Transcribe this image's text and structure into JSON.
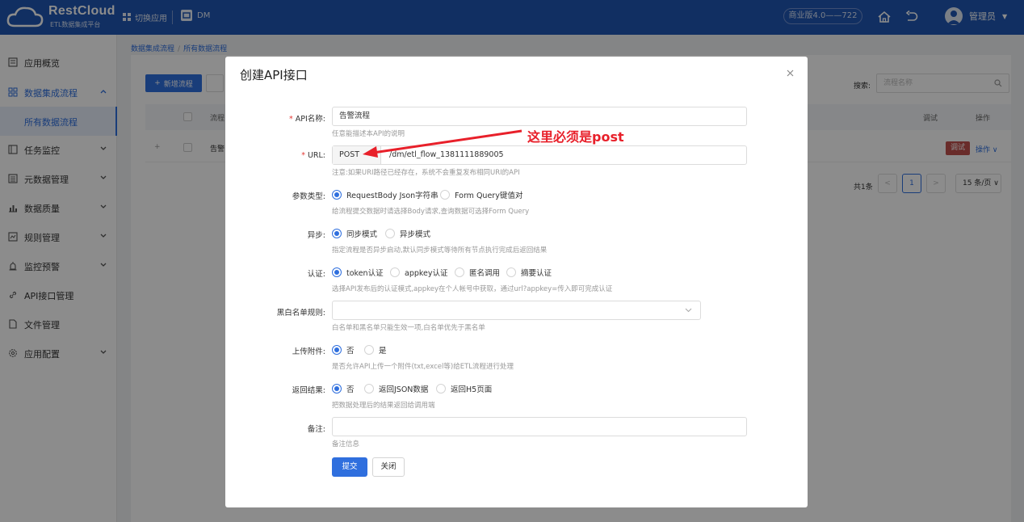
{
  "header": {
    "logo_title": "RestCloud",
    "logo_subtitle": "ETL数据集成平台",
    "switch_app": "切换应用",
    "app_name": "DM",
    "version": "商业版4.0——722",
    "user": "管理员"
  },
  "sidebar": {
    "items": [
      {
        "label": "应用概览",
        "icon": "overview-icon"
      },
      {
        "label": "数据集成流程",
        "icon": "grid-icon",
        "expanded": true
      },
      {
        "label": "所有数据流程",
        "active": true
      },
      {
        "label": "任务监控",
        "icon": "monitor-icon"
      },
      {
        "label": "元数据管理",
        "icon": "list-icon"
      },
      {
        "label": "数据质量",
        "icon": "bar-chart-icon"
      },
      {
        "label": "规则管理",
        "icon": "rule-icon"
      },
      {
        "label": "监控预警",
        "icon": "alarm-icon"
      },
      {
        "label": "API接口管理",
        "icon": "link-icon"
      },
      {
        "label": "文件管理",
        "icon": "file-icon"
      },
      {
        "label": "应用配置",
        "icon": "settings-icon"
      }
    ]
  },
  "breadcrumb": [
    "数据集成流程",
    "所有数据流程"
  ],
  "main": {
    "add_label": "新增流程",
    "search_label": "搜索:",
    "search_placeholder": "流程名称",
    "columns": [
      "流程",
      "调试",
      "操作"
    ],
    "row": {
      "name": "告警",
      "debug": "调试",
      "action": "操作"
    },
    "total": "共1条",
    "page": "1",
    "page_size": "15 条/页"
  },
  "modal": {
    "title": "创建API接口",
    "api_name_label": "API名称:",
    "api_name_value": "告警流程",
    "api_name_help": "任意能描述本API的说明",
    "url_label": "URL:",
    "url_method": "POST",
    "url_value": "/dm/etl_flow_1381111889005",
    "url_help": "注意:如果URI路径已经存在，系统不会重复发布相同URI的API",
    "param_label": "参数类型:",
    "param_options": [
      "RequestBody Json字符串",
      "Form Query键值对"
    ],
    "param_help": "给流程提交数据时请选择Body请求,查询数据可选择Form Query",
    "async_label": "异步:",
    "async_options": [
      "同步模式",
      "异步模式"
    ],
    "async_help": "指定流程是否异步启动,默认同步模式等待所有节点执行完成后返回结果",
    "auth_label": "认证:",
    "auth_options": [
      "token认证",
      "appkey认证",
      "匿名调用",
      "摘要认证"
    ],
    "auth_help": "选择API发布后的认证模式,appkey在个人帐号中获取，通过url?appkey=传入即可完成认证",
    "bw_label": "黑白名单规则:",
    "bw_help": "白名单和黑名单只能生效一项,白名单优先于黑名单",
    "upload_label": "上传附件:",
    "upload_options": [
      "否",
      "是"
    ],
    "upload_help": "是否允许API上传一个附件(txt,excel等)给ETL流程进行处理",
    "return_label": "返回结果:",
    "return_options": [
      "否",
      "返回JSON数据",
      "返回H5页面"
    ],
    "return_help": "把数据处理后的结果返回给调用端",
    "remark_label": "备注:",
    "remark_help": "备注信息",
    "submit": "提交",
    "close": "关闭"
  },
  "annotation": "这里必须是post",
  "colors": {
    "header": "#1f56b2",
    "accent": "#2f6fde",
    "annotation": "#e8202a",
    "debug_badge": "#c0504d"
  }
}
